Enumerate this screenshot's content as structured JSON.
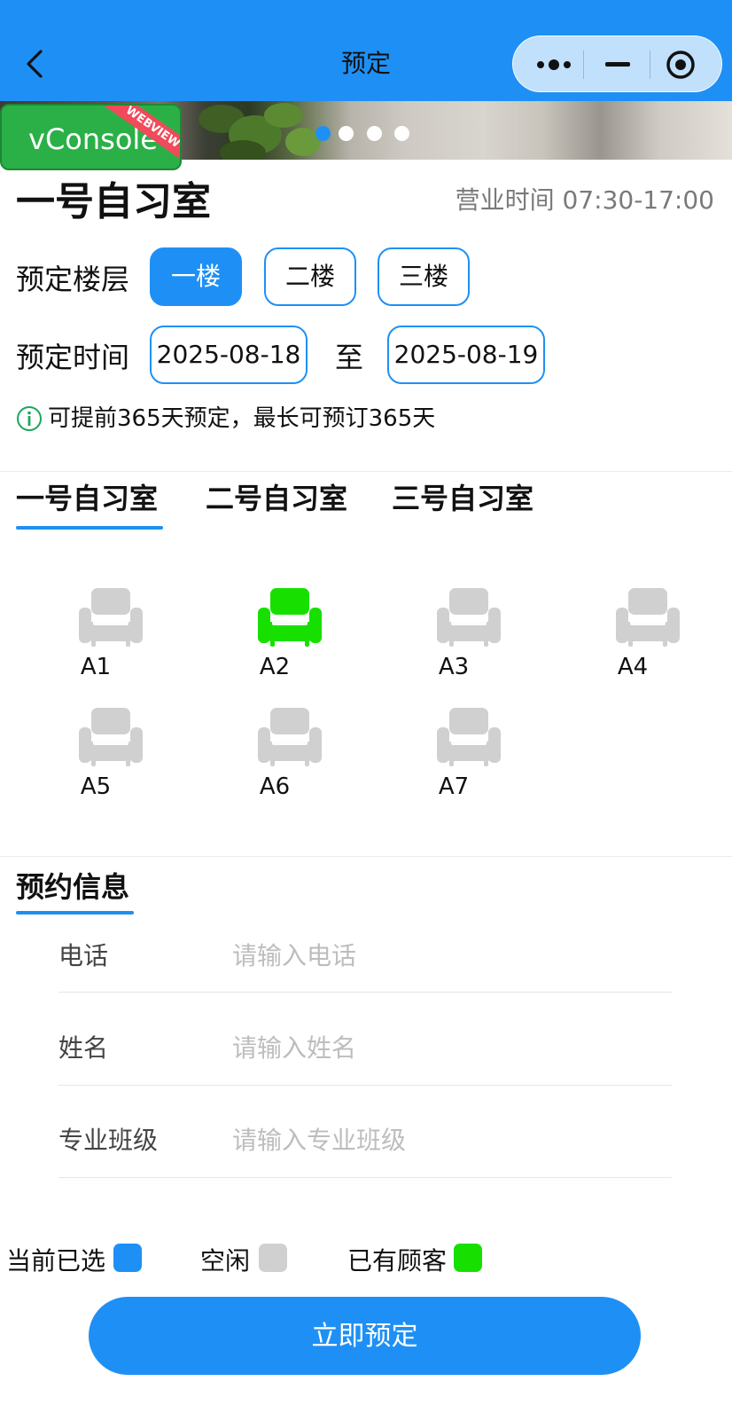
{
  "nav": {
    "title": "预定"
  },
  "banner": {
    "dots": 4,
    "active_dot": 0
  },
  "vconsole": {
    "label": "vConsole",
    "ribbon": "WEBVIEW"
  },
  "room": {
    "title": "一号自习室",
    "hours": "营业时间 07:30-17:00"
  },
  "floor": {
    "label": "预定楼层",
    "options": [
      "一楼",
      "二楼",
      "三楼"
    ],
    "selected": 0
  },
  "time": {
    "label": "预定时间",
    "start": "2025-08-18",
    "to": "至",
    "end": "2025-08-19"
  },
  "notice": "可提前365天预定，最长可预订365天",
  "tabs": {
    "items": [
      "一号自习室",
      "二号自习室",
      "三号自习室"
    ],
    "active": 0
  },
  "seats": [
    {
      "label": "A1",
      "state": "free"
    },
    {
      "label": "A2",
      "state": "occupied"
    },
    {
      "label": "A3",
      "state": "free"
    },
    {
      "label": "A4",
      "state": "free"
    },
    {
      "label": "A5",
      "state": "free"
    },
    {
      "label": "A6",
      "state": "free"
    },
    {
      "label": "A7",
      "state": "free"
    }
  ],
  "booking": {
    "title": "预约信息",
    "fields": [
      {
        "label": "电话",
        "placeholder": "请输入电话"
      },
      {
        "label": "姓名",
        "placeholder": "请输入姓名"
      },
      {
        "label": "专业班级",
        "placeholder": "请输入专业班级"
      }
    ]
  },
  "legend": [
    {
      "label": "当前已选",
      "color": "#1e90f5"
    },
    {
      "label": "空闲",
      "color": "#d0d0d0"
    },
    {
      "label": "已有顾客",
      "color": "#17e000"
    }
  ],
  "colors": {
    "primary": "#1e90f5",
    "free": "#d0d0d0",
    "occupied": "#17e000"
  },
  "submit": {
    "label": "立即预定"
  }
}
